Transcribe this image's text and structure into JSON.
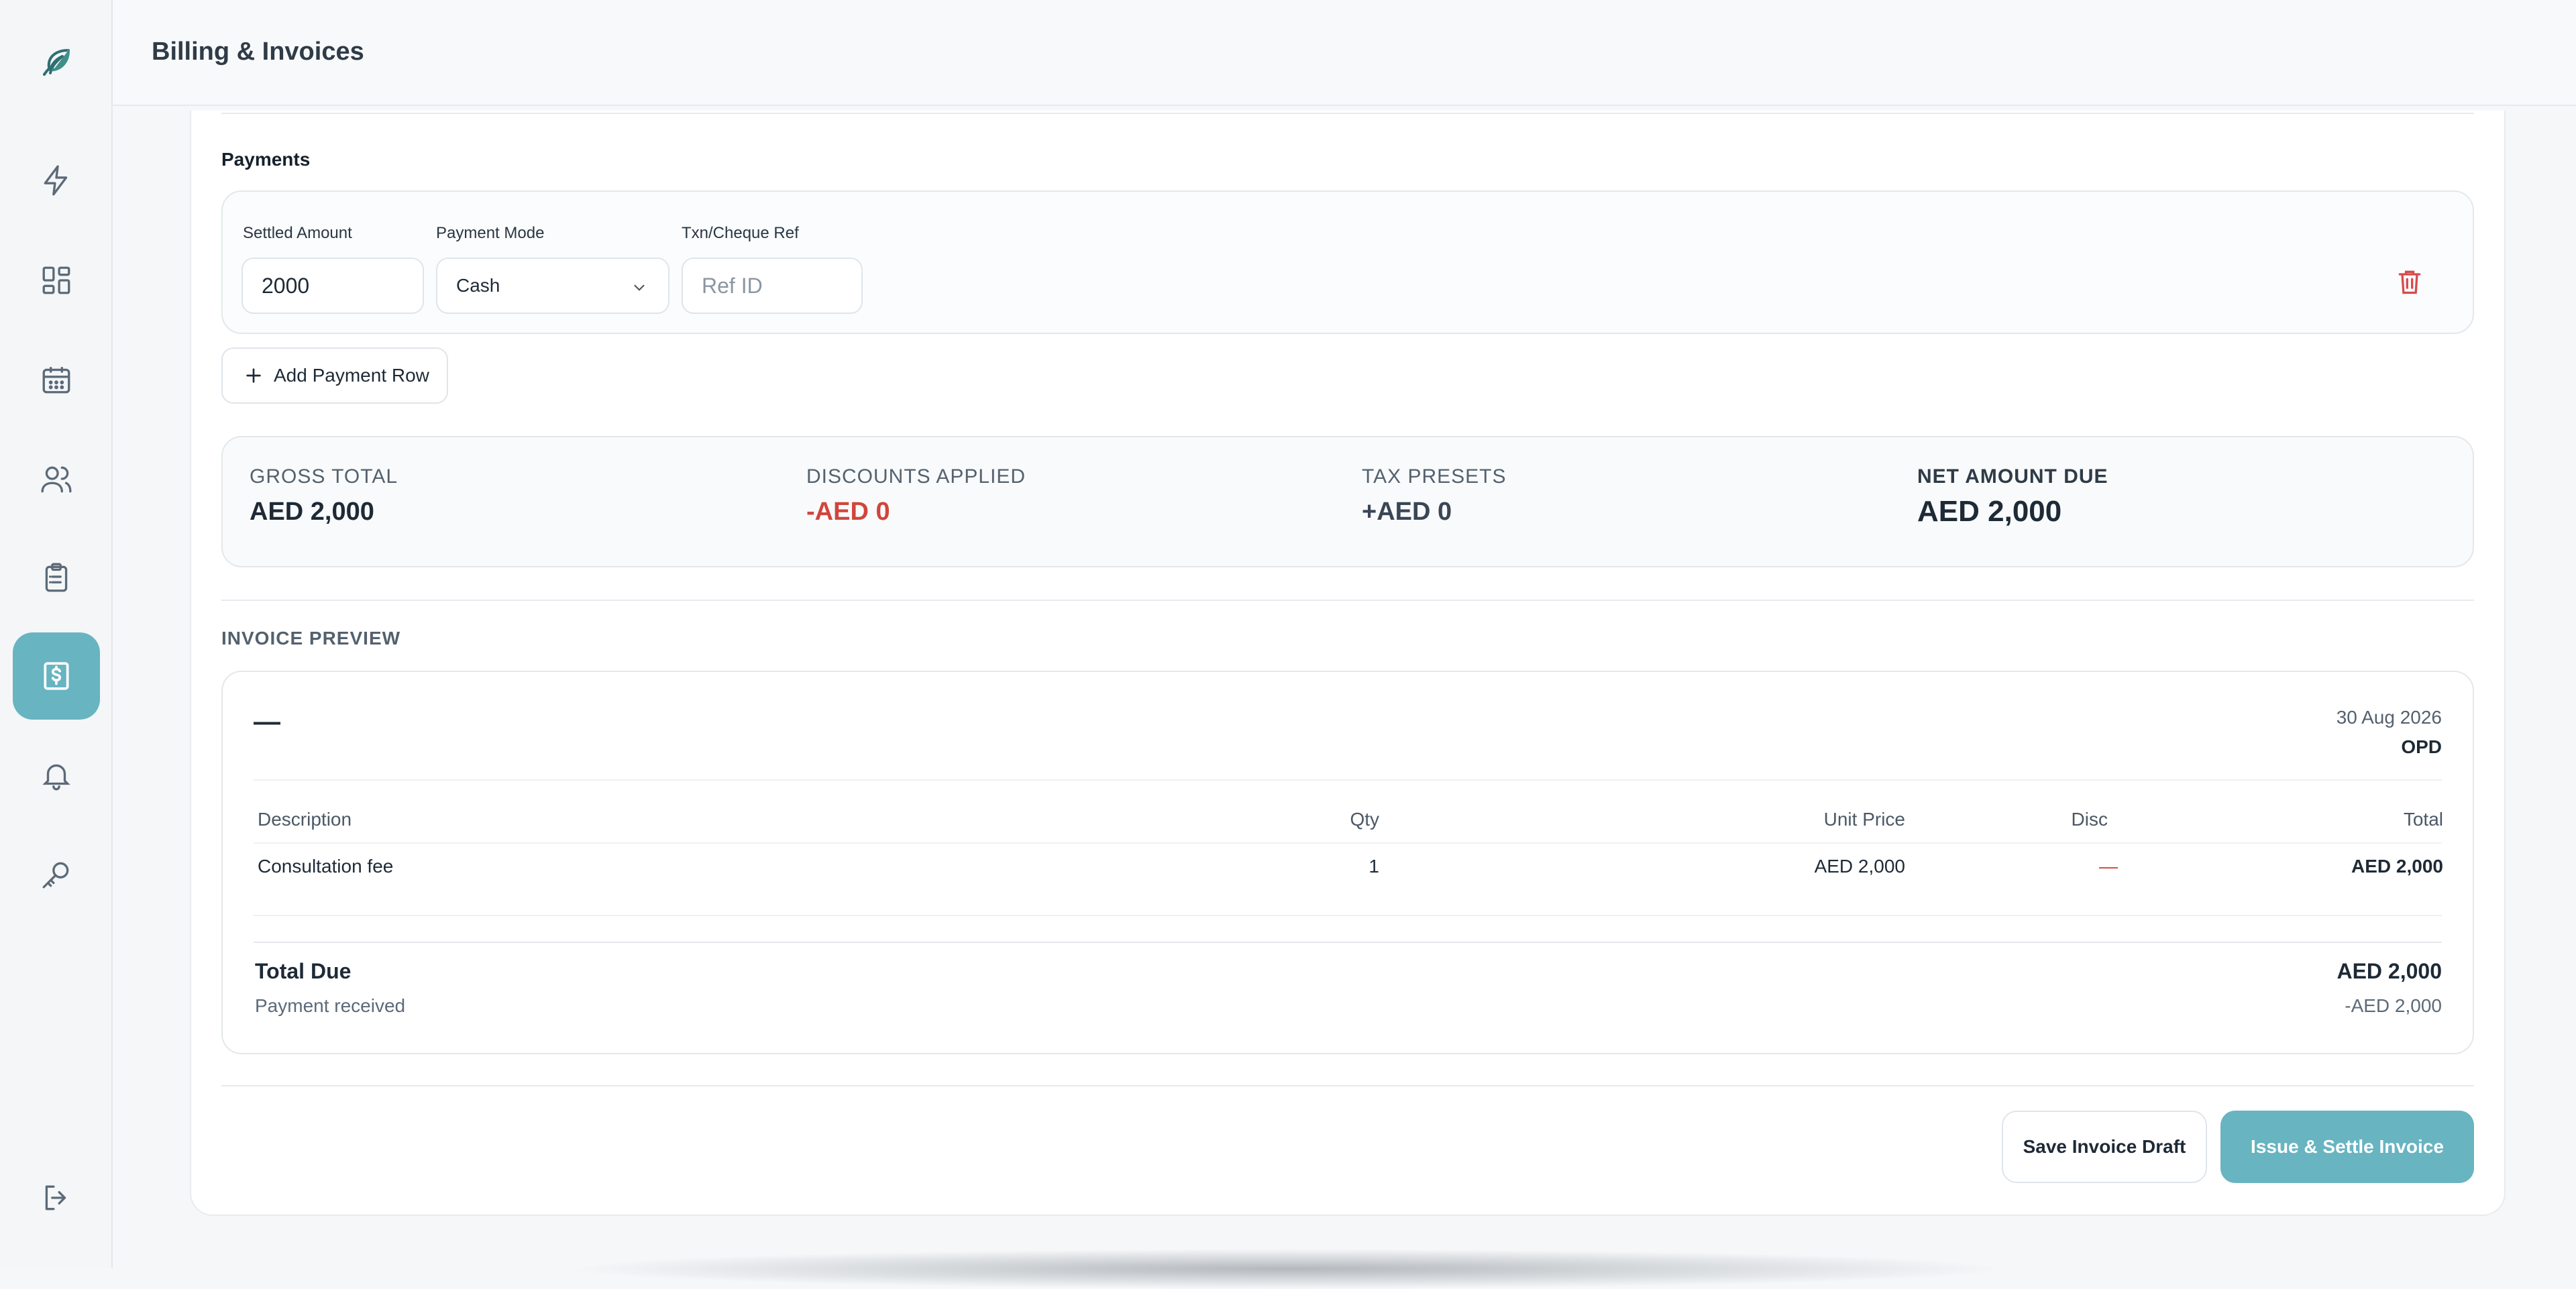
{
  "header": {
    "title": "Billing & Invoices"
  },
  "sidebar": {
    "items": [
      {
        "name": "logo",
        "icon": "leaf-logo-icon"
      },
      {
        "name": "quick-actions",
        "icon": "lightning-icon"
      },
      {
        "name": "dashboard",
        "icon": "grid-icon"
      },
      {
        "name": "calendar",
        "icon": "calendar-icon"
      },
      {
        "name": "patients",
        "icon": "users-icon"
      },
      {
        "name": "records",
        "icon": "clipboard-icon"
      },
      {
        "name": "billing",
        "icon": "invoice-dollar-icon",
        "active": true
      },
      {
        "name": "notifications",
        "icon": "bell-icon"
      },
      {
        "name": "access",
        "icon": "key-icon"
      },
      {
        "name": "logout",
        "icon": "logout-icon"
      }
    ],
    "accent": "#68b4c1"
  },
  "payments": {
    "title": "Payments",
    "row": {
      "settled_label": "Settled Amount",
      "settled_value": "2000",
      "mode_label": "Payment Mode",
      "mode_value": "Cash",
      "ref_label": "Txn/Cheque Ref",
      "ref_placeholder": "Ref ID"
    },
    "add_row_label": "Add Payment Row"
  },
  "totals": {
    "gross_label": "GROSS TOTAL",
    "gross_value": "AED 2,000",
    "discounts_label": "DISCOUNTS APPLIED",
    "discounts_value": "-AED 0",
    "tax_label": "TAX PRESETS",
    "tax_value": "+AED 0",
    "net_label": "NET AMOUNT DUE",
    "net_value": "AED 2,000"
  },
  "preview": {
    "label": "INVOICE PREVIEW",
    "number": "—",
    "date": "30 Aug 2026",
    "type": "OPD",
    "columns": {
      "description": "Description",
      "qty": "Qty",
      "unit_price": "Unit Price",
      "disc": "Disc",
      "total": "Total"
    },
    "rows": [
      {
        "description": "Consultation fee",
        "qty": "1",
        "unit_price": "AED 2,000",
        "disc": "—",
        "total": "AED 2,000"
      }
    ],
    "total_due_label": "Total Due",
    "total_due_value": "AED 2,000",
    "payment_received_label": "Payment received",
    "payment_received_value": "-AED 2,000"
  },
  "actions": {
    "save_draft_label": "Save Invoice Draft",
    "issue_label": "Issue & Settle Invoice"
  },
  "colors": {
    "accent": "#68b4c1",
    "negative": "#d1453b",
    "trash": "#d84a4a"
  }
}
